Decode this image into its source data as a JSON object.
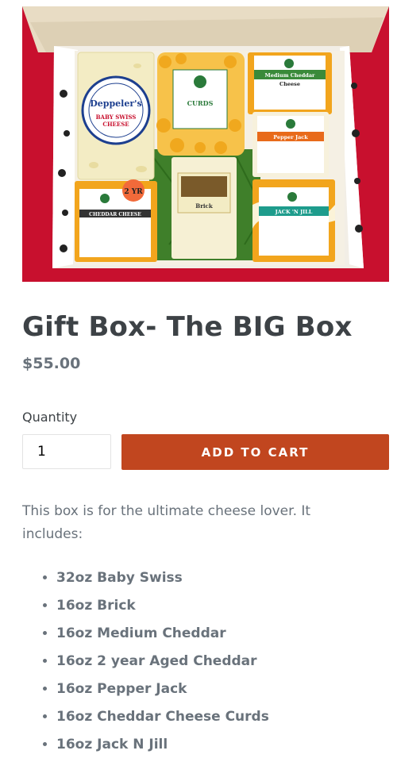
{
  "product": {
    "title": "Gift Box- The BIG Box",
    "price": "$55.00"
  },
  "photo": {
    "labels": {
      "deppelers": "Deppeler's",
      "baby_swiss": "BABY SWISS",
      "baby_swiss_2": "CHEESE",
      "curds": "CURDS",
      "medium_cheddar": "Medium Cheddar",
      "medium_cheddar_2": "Cheese",
      "pepper_jack": "Pepper Jack",
      "brick": "Brick",
      "cheddar_cheese": "CHEDDAR CHEESE",
      "two_yr": "2 YR",
      "jack_n_jill": "JACK 'N JILL"
    },
    "colors": {
      "background": "#c8102e",
      "box": "#e6d6b6",
      "cheddar": "#f2a51d",
      "swiss": "#f3ecc4"
    }
  },
  "form": {
    "quantity_label": "Quantity",
    "quantity_value": "1",
    "add_to_cart_label": "ADD TO CART",
    "button_color": "#c1461f"
  },
  "description": {
    "intro": "This box is for the ultimate cheese lover. It includes:",
    "items": [
      "32oz Baby Swiss",
      "16oz Brick",
      "16oz Medium Cheddar",
      "16oz 2 year Aged Cheddar",
      "16oz Pepper Jack",
      "16oz Cheddar Cheese Curds",
      "16oz Jack N Jill"
    ]
  }
}
